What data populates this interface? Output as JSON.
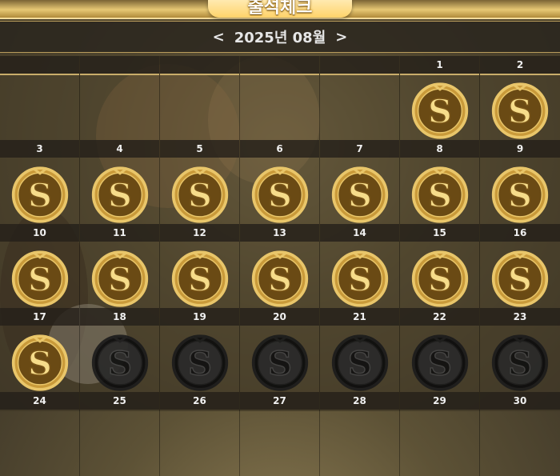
{
  "header": {
    "title": "출석체크"
  },
  "calendar": {
    "month_label": "2025년 08월",
    "prev_label": "<",
    "next_label": ">",
    "weeks": [
      [
        {
          "day": "",
          "status": "none"
        },
        {
          "day": "",
          "status": "none"
        },
        {
          "day": "",
          "status": "none"
        },
        {
          "day": "",
          "status": "none"
        },
        {
          "day": "",
          "status": "none"
        },
        {
          "day": "1",
          "status": "checked"
        },
        {
          "day": "2",
          "status": "checked"
        }
      ],
      [
        {
          "day": "3",
          "status": "checked"
        },
        {
          "day": "4",
          "status": "checked"
        },
        {
          "day": "5",
          "status": "checked"
        },
        {
          "day": "6",
          "status": "checked"
        },
        {
          "day": "7",
          "status": "checked"
        },
        {
          "day": "8",
          "status": "checked"
        },
        {
          "day": "9",
          "status": "checked"
        }
      ],
      [
        {
          "day": "10",
          "status": "checked"
        },
        {
          "day": "11",
          "status": "checked"
        },
        {
          "day": "12",
          "status": "checked"
        },
        {
          "day": "13",
          "status": "checked"
        },
        {
          "day": "14",
          "status": "checked"
        },
        {
          "day": "15",
          "status": "checked"
        },
        {
          "day": "16",
          "status": "checked"
        }
      ],
      [
        {
          "day": "17",
          "status": "checked"
        },
        {
          "day": "18",
          "status": "unchecked"
        },
        {
          "day": "19",
          "status": "unchecked"
        },
        {
          "day": "20",
          "status": "unchecked"
        },
        {
          "day": "21",
          "status": "unchecked"
        },
        {
          "day": "22",
          "status": "unchecked"
        },
        {
          "day": "23",
          "status": "unchecked"
        }
      ],
      [
        {
          "day": "24",
          "status": "none"
        },
        {
          "day": "25",
          "status": "none"
        },
        {
          "day": "26",
          "status": "none"
        },
        {
          "day": "27",
          "status": "none"
        },
        {
          "day": "28",
          "status": "none"
        },
        {
          "day": "29",
          "status": "none"
        },
        {
          "day": "30",
          "status": "none"
        }
      ]
    ]
  },
  "colors": {
    "gold": "#e9c66a",
    "gold_dark": "#8a6520",
    "grey_coin": "#1c1c1c"
  },
  "icons": {
    "checked": "gold-s-coin-icon",
    "unchecked": "grey-s-coin-icon"
  }
}
